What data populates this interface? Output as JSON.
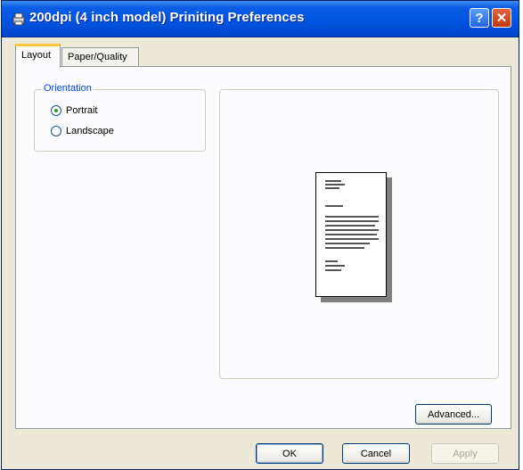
{
  "window": {
    "title": "200dpi (4 inch model) Priniting Preferences",
    "help_label": "?",
    "close_label": "✕"
  },
  "tabs": [
    {
      "label": "Layout",
      "active": true
    },
    {
      "label": "Paper/Quality",
      "active": false
    }
  ],
  "orientation": {
    "legend": "Orientation",
    "options": [
      {
        "label": "Portrait",
        "selected": true
      },
      {
        "label": "Landscape",
        "selected": false
      }
    ]
  },
  "buttons": {
    "advanced": "Advanced...",
    "ok": "OK",
    "cancel": "Cancel",
    "apply": "Apply"
  },
  "colors": {
    "titlebar": "#0054e3",
    "dialog_bg": "#ece9d8",
    "legend": "#0046d5",
    "active_tab_accent": "#ffc83c"
  },
  "icons": {
    "title": "printer-icon",
    "help": "help-icon",
    "close": "close-icon"
  }
}
